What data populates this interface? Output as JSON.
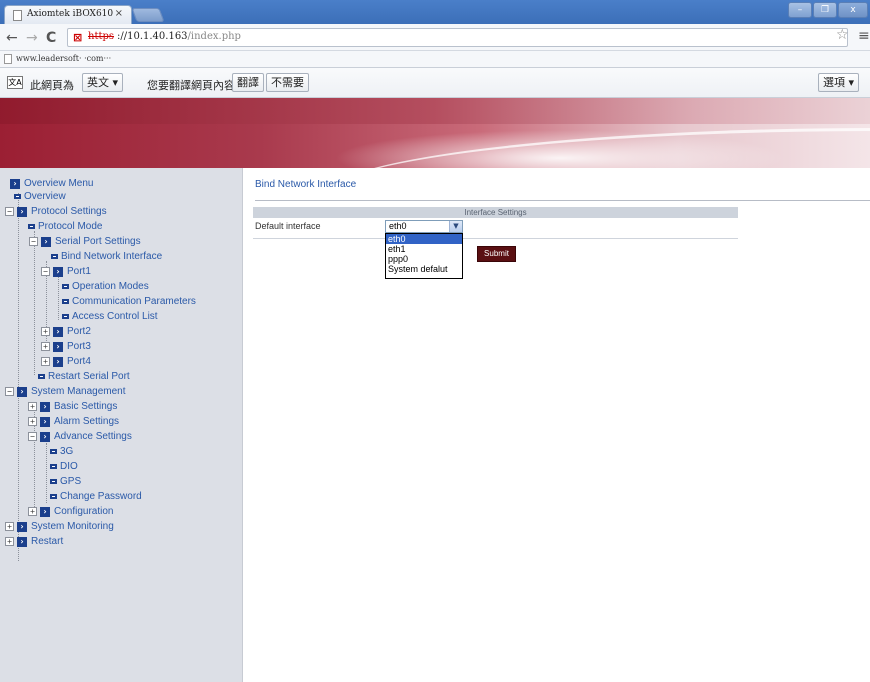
{
  "browser": {
    "tab_title": "Axiomtek iBOX610",
    "tab_close": "×",
    "url_scheme": "https",
    "url_rest_main": "://10.1.40.163",
    "url_rest_path": "/index.php",
    "bookmark": "www.leadersoft· ·com···",
    "translate_bar": {
      "prefix": "此網頁為",
      "language": "英文",
      "question": "您要翻譯網頁內容嗎？",
      "translate_button": "翻譯",
      "decline_button": "不需要",
      "options_button": "選項"
    },
    "window_buttons": [
      "–",
      "❐",
      "x"
    ]
  },
  "sidebar": {
    "nodes": [
      {
        "label": "Overview Menu",
        "type": "folder"
      },
      {
        "label": "Overview",
        "type": "leaf"
      },
      {
        "label": "Protocol Settings",
        "type": "folder",
        "expander": "−"
      },
      {
        "label": "Protocol Mode",
        "type": "leaf"
      },
      {
        "label": "Serial Port Settings",
        "type": "folder",
        "expander": "−"
      },
      {
        "label": "Bind Network Interface",
        "type": "leaf"
      },
      {
        "label": "Port1",
        "type": "folder",
        "expander": "−"
      },
      {
        "label": "Operation Modes",
        "type": "leaf"
      },
      {
        "label": "Communication Parameters",
        "type": "leaf"
      },
      {
        "label": "Access Control List",
        "type": "leaf"
      },
      {
        "label": "Port2",
        "type": "folder",
        "expander": "+"
      },
      {
        "label": "Port3",
        "type": "folder",
        "expander": "+"
      },
      {
        "label": "Port4",
        "type": "folder",
        "expander": "+"
      },
      {
        "label": "Restart Serial Port",
        "type": "leaf"
      },
      {
        "label": "System Management",
        "type": "folder",
        "expander": "−"
      },
      {
        "label": "Basic Settings",
        "type": "folder",
        "expander": "+"
      },
      {
        "label": "Alarm Settings",
        "type": "folder",
        "expander": "+"
      },
      {
        "label": "Advance Settings",
        "type": "folder",
        "expander": "−"
      },
      {
        "label": "3G",
        "type": "leaf"
      },
      {
        "label": "DIO",
        "type": "leaf"
      },
      {
        "label": "GPS",
        "type": "leaf"
      },
      {
        "label": "Change Password",
        "type": "leaf"
      },
      {
        "label": "Configuration",
        "type": "folder",
        "expander": "+"
      },
      {
        "label": "System Monitoring",
        "type": "folder",
        "expander": "+"
      },
      {
        "label": "Restart",
        "type": "folder",
        "expander": "+"
      }
    ]
  },
  "main": {
    "heading": "Bind Network Interface",
    "section_title": "Interface Settings",
    "field_label": "Default interface",
    "select_value": "eth0",
    "options": [
      "eth0",
      "eth1",
      "ppp0",
      "System defalut"
    ],
    "highlighted_option": "eth0",
    "submit_label": "Submit"
  },
  "colors": {
    "link_blue": "#2a59a8",
    "tree_icon": "#1b3f8c",
    "submit_bg": "#5a0f12",
    "banner_red": "#9b1f33"
  }
}
